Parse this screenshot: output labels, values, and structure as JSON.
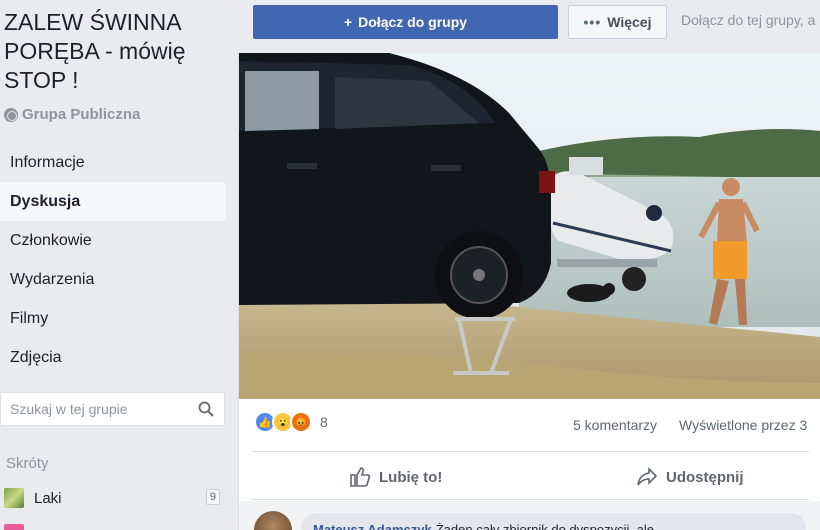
{
  "group": {
    "title": "ZALEW ŚWINNA PORĘBA - mówię STOP !",
    "privacy": "Grupa Publiczna"
  },
  "sidebar": {
    "items": [
      {
        "label": "Informacje",
        "active": false
      },
      {
        "label": "Dyskusja",
        "active": true
      },
      {
        "label": "Członkowie",
        "active": false
      },
      {
        "label": "Wydarzenia",
        "active": false
      },
      {
        "label": "Filmy",
        "active": false
      },
      {
        "label": "Zdjęcia",
        "active": false
      }
    ],
    "search_placeholder": "Szukaj w tej grupie",
    "shortcuts_title": "Skróty",
    "shortcuts": [
      {
        "label": "Laki",
        "count": "9"
      }
    ]
  },
  "topbar": {
    "join_label": "Dołącz do grupy",
    "more_label": "Więcej",
    "hint": "Dołącz do tej grupy, a"
  },
  "post": {
    "reactions_count": "8",
    "comments": "5 komentarzy",
    "views": "Wyświetlone przez 3",
    "like_label": "Lubię to!",
    "share_label": "Udostępnij",
    "comment": {
      "author": "Mateusz Adamczyk",
      "text": "Żaden cały zbiornik do dyspozycji, ale"
    }
  },
  "colors": {
    "brand": "#4267b2",
    "background": "#e9ebee",
    "link": "#385898"
  }
}
